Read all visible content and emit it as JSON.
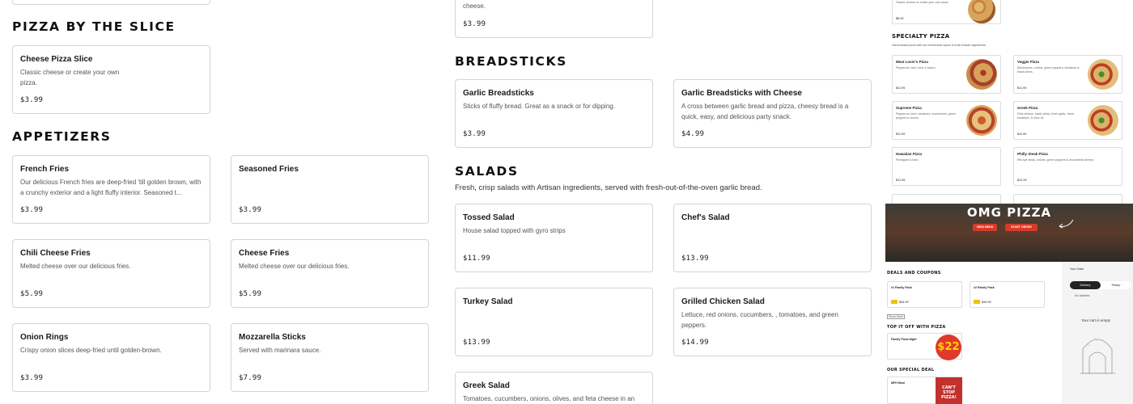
{
  "sections": {
    "pizza_slice": {
      "title": "PIZZA BY THE SLICE"
    },
    "appetizers": {
      "title": "APPETIZERS"
    },
    "breadsticks": {
      "title": "BREADSTICKS"
    },
    "salads": {
      "title": "SALADS",
      "subtitle": "Fresh, crisp salads with Artisan ingredients, served with fresh-out-of-the-oven garlic bread."
    }
  },
  "cards": {
    "top_partial_left": {
      "name": "",
      "desc": "",
      "price": ""
    },
    "top_partial_mid": {
      "desc": "cheese.",
      "price": "$3.99"
    },
    "cheese_slice": {
      "name": "Cheese Pizza Slice",
      "desc": "Classic cheese or create your own pizza.",
      "price": "$3.99"
    },
    "french_fries": {
      "name": "French Fries",
      "desc": "Our delicious French fries are deep-fried 'till golden brown, with a crunchy exterior and a light fluffy interior. Seasoned t...",
      "price": "$3.99"
    },
    "seasoned_fries": {
      "name": "Seasoned Fries",
      "desc": "",
      "price": "$3.99"
    },
    "chili_cheese_fries": {
      "name": "Chili Cheese Fries",
      "desc": "Melted cheese over our delicious fries.",
      "price": "$5.99"
    },
    "cheese_fries": {
      "name": "Cheese Fries",
      "desc": "Melted cheese over our delicious fries.",
      "price": "$5.99"
    },
    "onion_rings": {
      "name": "Onion Rings",
      "desc": "Crispy onion slices deep-fried until golden-brown.",
      "price": "$3.99"
    },
    "mozzarella_sticks": {
      "name": "Mozzarella Sticks",
      "desc": "Served with marinara sauce.",
      "price": "$7.99"
    },
    "garlic_breadsticks": {
      "name": "Garlic Breadsticks",
      "desc": "Sticks of fluffy bread. Great as a snack or for dipping.",
      "price": "$3.99"
    },
    "garlic_breadsticks_cheese": {
      "name": "Garlic Breadsticks with Cheese",
      "desc": "A cross between garlic bread and pizza, cheesy bread is a quick, easy, and delicious party snack.",
      "price": "$4.99"
    },
    "tossed_salad": {
      "name": "Tossed Salad",
      "desc": "House salad topped with gyro strips",
      "price": "$11.99"
    },
    "chefs_salad": {
      "name": "Chef's Salad",
      "desc": "",
      "price": "$13.99"
    },
    "turkey_salad": {
      "name": "Turkey Salad",
      "desc": "",
      "price": "$13.99"
    },
    "grilled_chicken_salad": {
      "name": "Grilled Chicken Salad",
      "desc": "Lettuce, red onions, cucumbers, , tomatoes, and green peppers.",
      "price": "$14.99"
    },
    "greek_salad": {
      "name": "Greek Salad",
      "desc": "Tomatoes, cucumbers, onions, olives, and feta cheese in an",
      "price": ""
    }
  },
  "thumbnail": {
    "top_card": {
      "desc": "Classic cheese or create your own pizza.",
      "price": "$8.99"
    },
    "specialty_title": "SPECIALTY PIZZA",
    "specialty_sub": "Hand-tossed pizza with our homemade sauce & fresh Artisan ingredients.",
    "items": [
      {
        "name": "Meat Lover's Pizza",
        "desc": "Pepperoni, ham, beef & bacon.",
        "price": "$11.99"
      },
      {
        "name": "Veggie Pizza",
        "desc": "Mushrooms, onions, green peppers, tomatoes & black olives.",
        "price": "$11.99"
      },
      {
        "name": "Supreme Pizza",
        "desc": "Pepperoni, beef, tomatoes, mushrooms, green peppers & onions.",
        "price": "$11.99"
      },
      {
        "name": "Greek Pizza",
        "desc": "Feta cheese, black olives, fresh garlic, fresh tomatoes, & olive oil.",
        "price": "$11.99"
      },
      {
        "name": "Hawaiian Pizza",
        "desc": "Pineapple & ham.",
        "price": "$11.99"
      },
      {
        "name": "Philly Steak Pizza",
        "desc": "Rib-eye steak, onions, green peppers & mozzarella cheese.",
        "price": "$12.99"
      }
    ],
    "banner_title": "OMG PIZZA",
    "btn_menu": "VIEW MENU",
    "btn_order": "START ORDER",
    "deals_title": "DEALS AND COUPONS",
    "deal1": "#1 Family Pack",
    "deal2": "#2 Family Pack",
    "deal_price1": "$34.99",
    "deal_price2": "$34.99",
    "show_more": "Show More",
    "top_off_title": "TOP IT OFF WITH PIZZA",
    "family_night": "Family Pizza Night",
    "price_badge": "$22",
    "special_title": "OUR SPECIAL DEAL",
    "special_item": "MFH Meal",
    "can_stop": "CAN'T STOP PIZZA!",
    "your_order": "Your Order",
    "delivery": "Delivery",
    "pickup": "Pickup",
    "no_address": "No address",
    "cart_empty": "Your cart is empty"
  }
}
